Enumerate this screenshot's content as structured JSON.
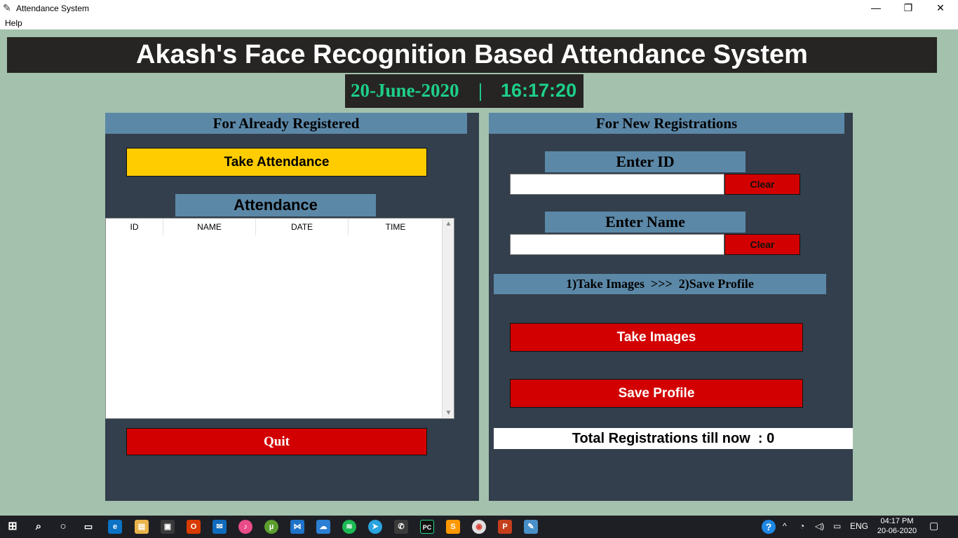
{
  "window": {
    "title": "Attendance System",
    "minimize_glyph": "—",
    "restore_glyph": "❐",
    "close_glyph": "✕"
  },
  "menu": {
    "help_label": "Help"
  },
  "header": {
    "title": "Akash's Face Recognition Based Attendance System"
  },
  "clock": {
    "date": "20-June-2020",
    "separator": "|",
    "time": "16:17:20"
  },
  "left_panel": {
    "heading": "For Already Registered",
    "take_attendance_label": "Take Attendance",
    "attendance_heading": "Attendance",
    "table": {
      "columns": [
        "ID",
        "NAME",
        "DATE",
        "TIME"
      ],
      "rows": []
    },
    "quit_label": "Quit"
  },
  "right_panel": {
    "heading": "For New Registrations",
    "enter_id_label": "Enter ID",
    "id_value": "",
    "clear_id_label": "Clear",
    "enter_name_label": "Enter Name",
    "name_value": "",
    "clear_name_label": "Clear",
    "instructions": "1)Take Images  >>>  2)Save Profile",
    "take_images_label": "Take Images",
    "save_profile_label": "Save Profile",
    "total_registrations": "Total Registrations till now  : 0"
  },
  "taskbar": {
    "language": "ENG",
    "time": "04:17 PM",
    "date": "20-06-2020"
  },
  "colors": {
    "background": "#a3c1ad",
    "dark": "#262523",
    "frame": "#333f4c",
    "label_blue": "#5c88a7",
    "clock_green": "#1ecf8a",
    "yellow": "#ffcc00",
    "red": "#d20000"
  }
}
